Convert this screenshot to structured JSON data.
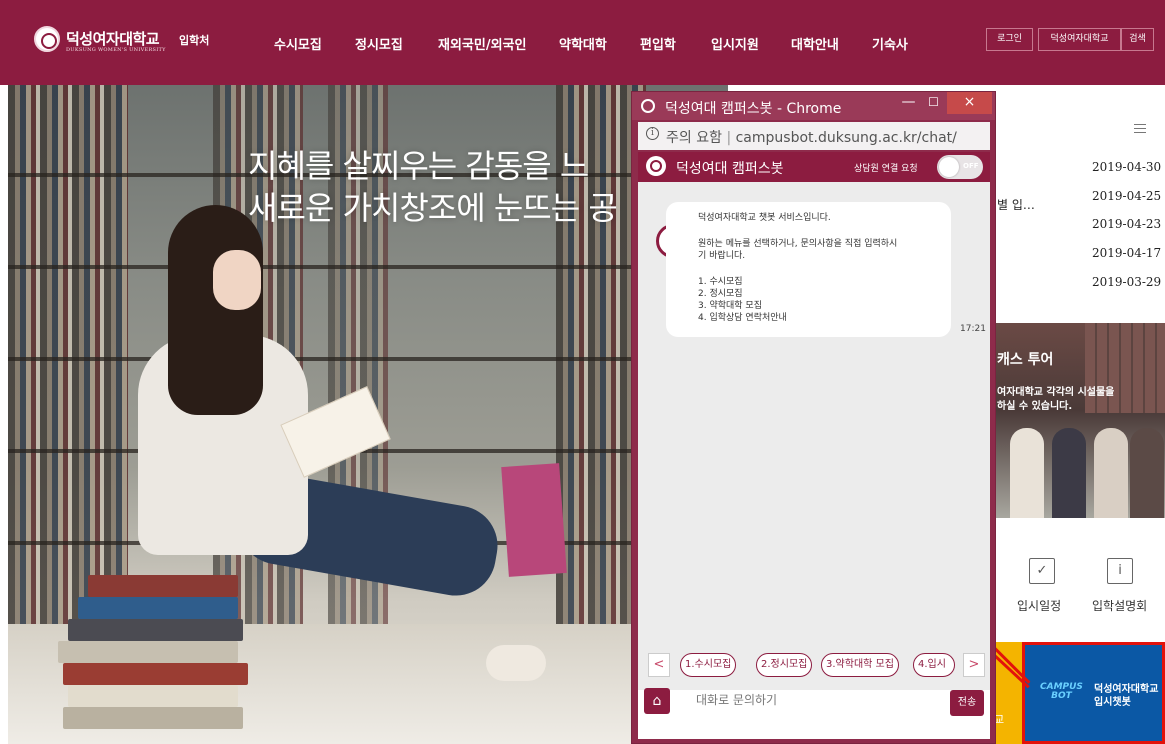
{
  "header": {
    "logo_name": "덕성여자대학교",
    "logo_sub": "DUKSUNG WOMEN'S UNIVERSITY",
    "office": "입학처",
    "nav": [
      "수시모집",
      "정시모집",
      "재외국민/외국인",
      "약학대학",
      "편입학",
      "입시지원",
      "대학안내",
      "기숙사"
    ],
    "util": [
      "로그인",
      "덕성여자대학교",
      "검색"
    ],
    "brand_color": "#8c1c40"
  },
  "hero": {
    "line1": "지혜를 살찌우는 감동을 느",
    "line2": "새로운 가치창조에 눈뜨는 공"
  },
  "notices": {
    "partial_title": "별 입…",
    "dates": [
      "2019-04-30",
      "2019-04-25",
      "2019-04-23",
      "2019-04-17",
      "2019-03-29"
    ]
  },
  "campus_tour": {
    "title": "캐스 투어",
    "desc_line1": "여자대학교 각각의 시설물을",
    "desc_line2": "하실 수 있습니다."
  },
  "quick_links": [
    {
      "label": "입시일정",
      "icon": "calendar-check-icon"
    },
    {
      "label": "입학설명회",
      "icon": "book-info-icon"
    }
  ],
  "campusbot_banner": {
    "logo_line1": "CAMPUS",
    "logo_line2": "BOT",
    "label_line1": "덕성여자대학교",
    "label_line2": "입시챗봇",
    "partial_left": "교"
  },
  "popup": {
    "window_title": "덕성여대 캠퍼스봇 - Chrome",
    "minimize": "—",
    "maximize": "☐",
    "close": "×",
    "address_warning": "주의 요함",
    "address_url": "campusbot.duksung.ac.kr/chat/",
    "chat_title": "덕성여대 캠퍼스봇",
    "connect_label": "상담원 연결 요청",
    "toggle_state": "OFF",
    "message_lines": [
      "덕성여자대학교 챗봇 서비스입니다.",
      "원하는 메뉴를 선택하거나, 문의사항을 직접 입력하시",
      "기 바랍니다.",
      "1. 수시모집",
      "2. 정시모집",
      "3. 약학대학 모집",
      "4. 입학상담 연락처안내"
    ],
    "message_time": "17:21",
    "quick_prev": "<",
    "quick_next": ">",
    "quick_replies": [
      "1.수시모집",
      "2.정시모집",
      "3.약학대학 모집",
      "4.입시"
    ],
    "input_placeholder": "대화로 문의하기",
    "send_label": "전송"
  }
}
